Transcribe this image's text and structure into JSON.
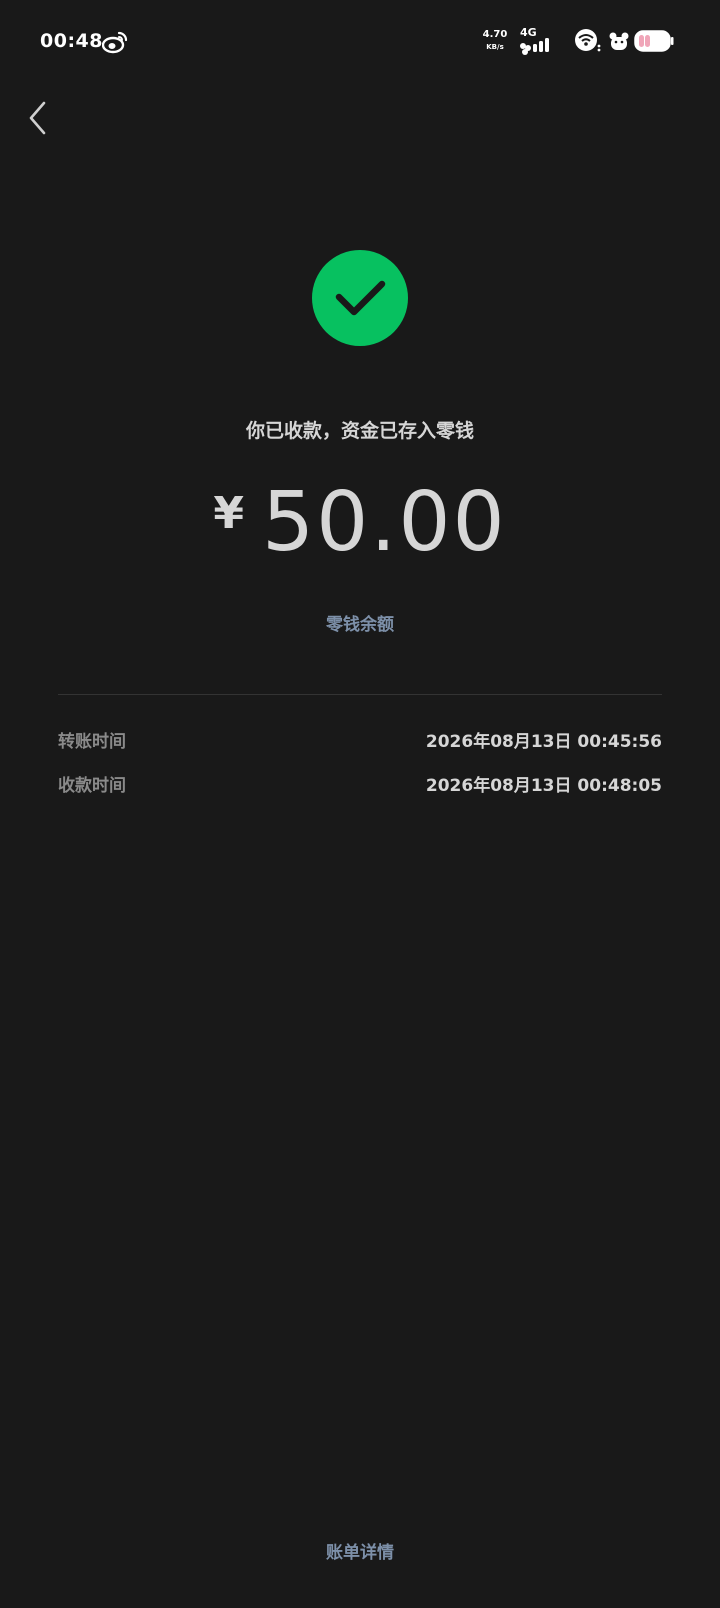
{
  "status_bar": {
    "time": "00:48",
    "net_speed_value": "4.70",
    "net_speed_unit": "KB/s",
    "network_type": "4G",
    "icons": [
      "weibo-icon",
      "signal-icon",
      "wifi-icon",
      "pet-icon",
      "battery-icon"
    ]
  },
  "header": {
    "back_icon": "chevron-left-icon"
  },
  "receipt": {
    "success_icon": "check-circle-icon",
    "success_color": "#07c160",
    "message": "你已收款，资金已存入零钱",
    "currency_symbol": "¥",
    "amount": "50.00",
    "balance_link": "零钱余额",
    "details": [
      {
        "label": "转账时间",
        "value": "2026年08月13日 00:45:56"
      },
      {
        "label": "收款时间",
        "value": "2026年08月13日 00:48:05"
      }
    ]
  },
  "footer": {
    "bill_details_link": "账单详情"
  },
  "colors": {
    "background": "#191919",
    "link": "#7d90a9",
    "text_primary": "#d6d6d6",
    "text_secondary": "#8a8a8a"
  }
}
